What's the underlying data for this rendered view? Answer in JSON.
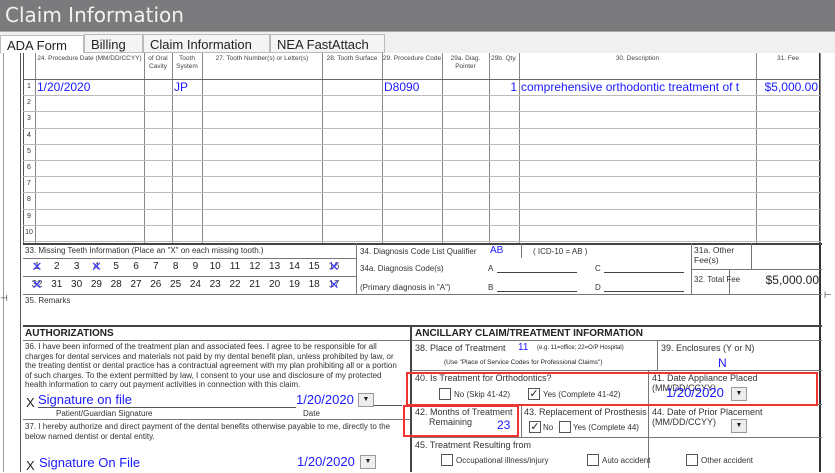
{
  "window": {
    "title": "Claim Information"
  },
  "tabs": [
    {
      "label": "ADA Form",
      "active": true
    },
    {
      "label": "Billing"
    },
    {
      "label": "Claim Information"
    },
    {
      "label": "NEA FastAttach"
    }
  ],
  "procedures": {
    "headers": {
      "date": "24. Procedure Date (MM/DD/CCYY)",
      "oral": "of Oral Cavity",
      "system": "Tooth System",
      "tooth": "27. Tooth Number(s) or Letter(s)",
      "surface": "28. Tooth Surface",
      "code": "29. Procedure Code",
      "pointer": "29a. Diag. Pointer",
      "qty": "29b. Qty.",
      "desc": "30. Description",
      "fee": "31. Fee"
    },
    "rows": [
      {
        "n": "1",
        "date": "1/20/2020",
        "oral": "",
        "system": "JP",
        "tooth": "",
        "surface": "",
        "code": "D8090",
        "pointer": "",
        "qty": "1",
        "desc": "comprehensive orthodontic treatment of t",
        "fee": "$5,000.00"
      },
      {
        "n": "2"
      },
      {
        "n": "3"
      },
      {
        "n": "4"
      },
      {
        "n": "5"
      },
      {
        "n": "6"
      },
      {
        "n": "7"
      },
      {
        "n": "8"
      },
      {
        "n": "9"
      },
      {
        "n": "10"
      }
    ]
  },
  "missing_teeth": {
    "label": "33. Missing Teeth Information   (Place an \"X\" on each missing tooth.)",
    "upper": [
      "1",
      "2",
      "3",
      "4",
      "5",
      "6",
      "7",
      "8",
      "9",
      "10",
      "11",
      "12",
      "13",
      "14",
      "15",
      "16"
    ],
    "lower": [
      "32",
      "31",
      "30",
      "29",
      "28",
      "27",
      "26",
      "25",
      "24",
      "23",
      "22",
      "21",
      "20",
      "19",
      "18",
      "17"
    ],
    "marked": [
      "1",
      "4",
      "16",
      "32",
      "17"
    ]
  },
  "diagnosis": {
    "qualifier_label": "34. Diagnosis Code List Qualifier",
    "qualifier": "AB",
    "icd_note": "( ICD-10 = AB )",
    "codes_label": "34a. Diagnosis Code(s)",
    "primary_note": "(Primary diagnosis in \"A\")",
    "a": "A",
    "b": "B",
    "c": "C",
    "d": "D"
  },
  "fees": {
    "other_label": "31a. Other Fee(s)",
    "other": "",
    "total_label": "32. Total Fee",
    "total": "$5,000.00"
  },
  "remarks": {
    "label": "35. Remarks",
    "value": ""
  },
  "authorizations": {
    "title": "AUTHORIZATIONS",
    "p36": "36. I have been informed of the treatment plan and associated fees. I agree to be responsible for all charges for dental services and materials not paid by my dental benefit plan, unless prohibited by law, or the treating dentist or dental practice has a contractual agreement with my plan prohibiting all or a portion of such charges. To the extent permitted by law, I consent to your use and disclosure of my protected health information to carry out payment activities in connection with this claim.",
    "sig36": "Signature on file",
    "date36": "1/20/2020",
    "sig36_label": "Patient/Guardian Signature",
    "date_label": "Date",
    "p37": "37. I hereby authorize and direct payment of the dental benefits otherwise payable to me, directly to the below named dentist or dental entity.",
    "sig37": "Signature On File",
    "date37": "1/20/2020",
    "x": "X"
  },
  "ancillary": {
    "title": "ANCILLARY CLAIM/TREATMENT INFORMATION",
    "place_label": "38. Place of Treatment",
    "place": "11",
    "place_hint": "(e.g. 11=office; 22=O/P Hospital)",
    "place_note": "(Use \"Place of Service Codes for Professional Claims\")",
    "enclosures_label": "39. Enclosures (Y or N)",
    "enclosures": "N",
    "ortho_label": "40. Is Treatment for Orthodontics?",
    "ortho_no": "No  (Skip 41-42)",
    "ortho_yes": "Yes (Complete 41-42)",
    "ortho_checked": "yes",
    "appliance_label": "41. Date Appliance Placed (MM/DD/CCYY)",
    "appliance_date": "1/20/2020",
    "months_label": "42. Months of Treatment",
    "months_label2": "Remaining",
    "months": "23",
    "prosthesis_label": "43. Replacement of Prosthesis",
    "prosthesis_no": "No",
    "prosthesis_yes": "Yes (Complete 44)",
    "prosthesis_checked": "no",
    "prior_label": "44. Date of Prior Placement (MM/DD/CCYY)",
    "prior_date": "",
    "resulting_label": "45. Treatment Resulting from",
    "occupational": "Occupational illness/injury",
    "auto": "Auto accident",
    "other": "Other accident"
  },
  "colors": {
    "value_text": "#1a1aff",
    "highlight": "#e33333",
    "titlebar": "#7b7b7e"
  }
}
